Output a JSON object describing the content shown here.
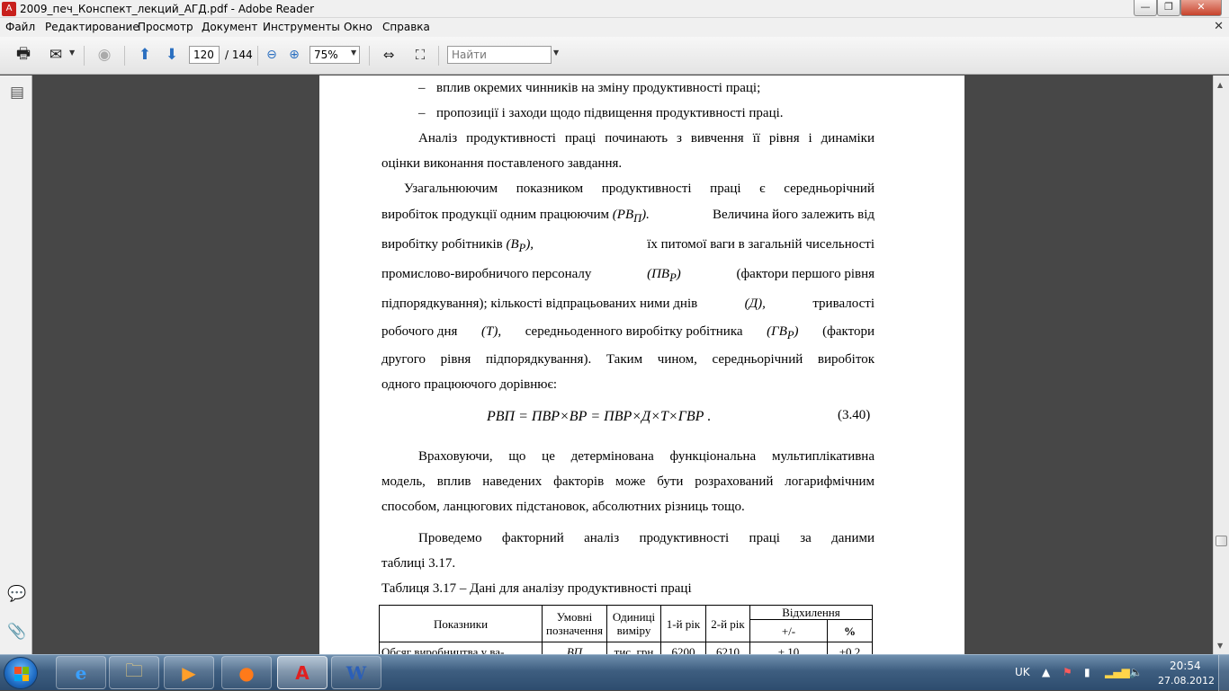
{
  "window": {
    "title": "2009_печ_Конспект_лекций_АГД.pdf - Adobe Reader"
  },
  "menu": [
    "Файл",
    "Редактирование",
    "Просмотр",
    "Документ",
    "Инструменты",
    "Окно",
    "Справка"
  ],
  "toolbar": {
    "current_page": "120",
    "page_total": "/ 144",
    "zoom": "75%",
    "search_placeholder": "Найти"
  },
  "document": {
    "bullets": [
      "вплив окремих чинників на зміну продуктивності праці;",
      "пропозиції і заходи щодо підвищення продуктивності праці."
    ],
    "bullet_dash": "–",
    "para1": {
      "line1": "Аналіз продуктивності праці починають з вивчення її рівня і динаміки",
      "line2": "оцінки виконання поставленого завдання."
    },
    "para2": {
      "l1": "Узагальнюючим показником продуктивності праці є середньорічний",
      "l2a": "виробіток продукції одним працюючим",
      "l2sym": "(РВ",
      "l2sub": "П",
      "l2close": ").",
      "l2b": "Величина його залежить від",
      "l3a": "виробітку робітників",
      "l3sym": "(В",
      "l3sub": "Р",
      "l3close": "),",
      "l3b": "їх питомої ваги в загальній чисельності",
      "l4a": "промислово-виробничого персоналу",
      "l4sym": "(ПВ",
      "l4sub": "Р",
      "l4close": ")",
      "l4b": "(фактори першого рівня",
      "l5a": "підпорядкування); кількості відпрацьованих ними днів",
      "l5sym": "(Д),",
      "l5b": "тривалості",
      "l6a": "робочого дня",
      "l6sym": "(Т),",
      "l6b": "середньоденного виробітку робітника",
      "l6sym2": "(ГВ",
      "l6sub": "Р",
      "l6close": ")",
      "l6c": "(фактори",
      "l7": "другого рівня підпорядкування). Таким чином, середньорічний виробіток",
      "l8": "одного працюючого дорівнює:"
    },
    "formula": {
      "text": "РВП = ПВР×ВР = ПВР×Д×Т×ГВР .",
      "number": "(3.40)"
    },
    "para3": {
      "l1": "Враховуючи, що це детермінована функціональна мультиплікативна",
      "l2": "модель, вплив наведених факторів може бути розрахований логарифмічним",
      "l3": "способом, ланцюгових підстановок, абсолютних різниць тощо."
    },
    "para4": {
      "l1": "Проведемо факторний аналіз продуктивності праці за даними",
      "l2": "таблиці 3.17."
    },
    "table_caption": "Таблиця 3.17 – Дані для аналізу продуктивності праці",
    "table": {
      "headers": {
        "indicators": "Показники",
        "symbols": "Умовні позначення",
        "units": "Одиниці виміру",
        "year1": "1-й рік",
        "year2": "2-й рік",
        "deviation": "Відхилення",
        "abs": "+/-",
        "pct": "%"
      },
      "row1": [
        "Обсяг виробництва у ва-",
        "ВП",
        "тис. грн",
        "6200",
        "6210",
        "+ 10",
        "+0,2"
      ]
    }
  },
  "taskbar": {
    "language": "UK",
    "time": "20:54",
    "date": "27.08.2012"
  }
}
